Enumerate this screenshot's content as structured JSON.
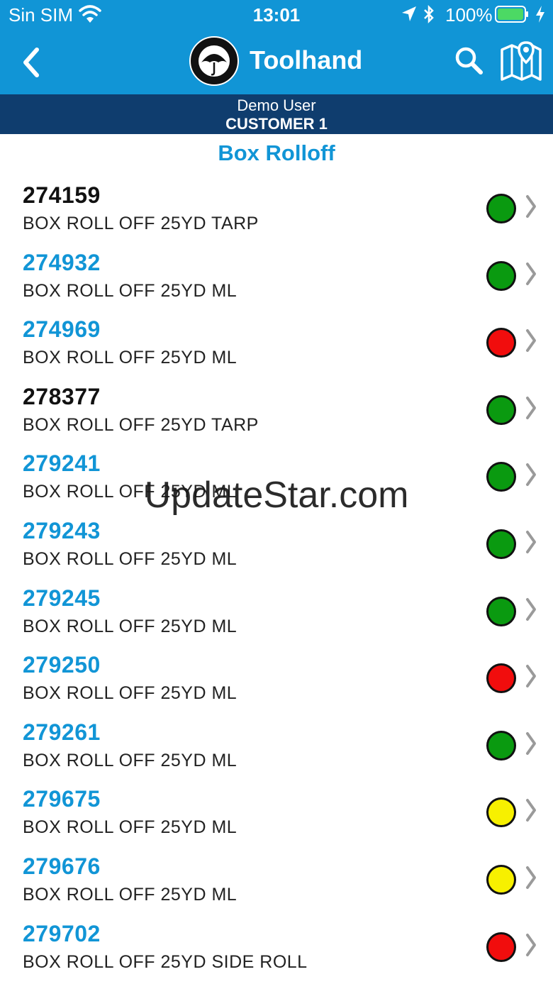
{
  "status_bar": {
    "carrier": "Sin SIM",
    "time": "13:01",
    "battery": "100%"
  },
  "nav": {
    "title": "Toolhand",
    "back_icon": "chevron-left-icon",
    "search_icon": "search-icon",
    "map_icon": "map-pin-icon",
    "logo_icon": "rain-for-rent-logo"
  },
  "user": {
    "name": "Demo User",
    "customer": "CUSTOMER 1"
  },
  "section_title": "Box Rolloff",
  "colors": {
    "brand_blue": "#1195D6",
    "navy": "#0F3D6E",
    "status_green": "#0A9A10",
    "status_red": "#F10D0D",
    "status_yellow": "#F7F000"
  },
  "items": [
    {
      "id": "274159",
      "desc": "BOX ROLL OFF 25YD TARP",
      "status": "green",
      "link": false
    },
    {
      "id": "274932",
      "desc": "BOX ROLL OFF 25YD ML",
      "status": "green",
      "link": true
    },
    {
      "id": "274969",
      "desc": "BOX ROLL OFF 25YD ML",
      "status": "red",
      "link": true
    },
    {
      "id": "278377",
      "desc": "BOX ROLL OFF 25YD TARP",
      "status": "green",
      "link": false
    },
    {
      "id": "279241",
      "desc": "BOX ROLL OFF 25YD ML",
      "status": "green",
      "link": true
    },
    {
      "id": "279243",
      "desc": "BOX ROLL OFF 25YD ML",
      "status": "green",
      "link": true
    },
    {
      "id": "279245",
      "desc": "BOX ROLL OFF 25YD ML",
      "status": "green",
      "link": true
    },
    {
      "id": "279250",
      "desc": "BOX ROLL OFF 25YD ML",
      "status": "red",
      "link": true
    },
    {
      "id": "279261",
      "desc": "BOX ROLL OFF 25YD ML",
      "status": "green",
      "link": true
    },
    {
      "id": "279675",
      "desc": "BOX ROLL OFF 25YD ML",
      "status": "yellow",
      "link": true
    },
    {
      "id": "279676",
      "desc": "BOX ROLL OFF 25YD ML",
      "status": "yellow",
      "link": true
    },
    {
      "id": "279702",
      "desc": "BOX ROLL OFF 25YD SIDE ROLL",
      "status": "red",
      "link": true
    }
  ],
  "watermark": "UpdateStar.com"
}
